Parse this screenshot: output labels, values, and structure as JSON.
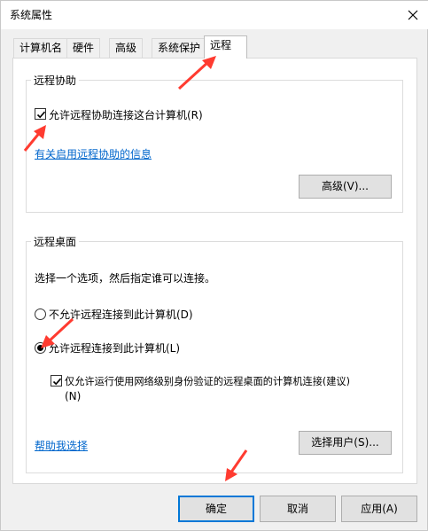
{
  "window": {
    "title": "系统属性"
  },
  "tabs": [
    {
      "label": "计算机名"
    },
    {
      "label": "硬件"
    },
    {
      "label": "高级"
    },
    {
      "label": "系统保护"
    },
    {
      "label": "远程"
    }
  ],
  "remote_assistance": {
    "group_title": "远程协助",
    "allow_checkbox_label": "允许远程协助连接这台计算机(R)",
    "allow_checked": true,
    "info_link": "有关启用远程协助的信息",
    "advanced_button": "高级(V)..."
  },
  "remote_desktop": {
    "group_title": "远程桌面",
    "instruction": "选择一个选项，然后指定谁可以连接。",
    "option_deny": "不允许远程连接到此计算机(D)",
    "option_allow": "允许远程连接到此计算机(L)",
    "selected_option": "option_allow",
    "nla_checkbox_line1": "仅允许运行使用网络级别身份验证的远程桌面的计算机连接(建议)",
    "nla_checkbox_line2": "(N)",
    "nla_checked": true,
    "help_link": "帮助我选择",
    "select_users_button": "选择用户(S)..."
  },
  "footer": {
    "ok_button": "确定",
    "cancel_button": "取消",
    "apply_button": "应用(A)"
  },
  "colors": {
    "annotation_arrow": "#ff3b30",
    "link": "#0066cc",
    "default_button_border": "#0078d7"
  }
}
